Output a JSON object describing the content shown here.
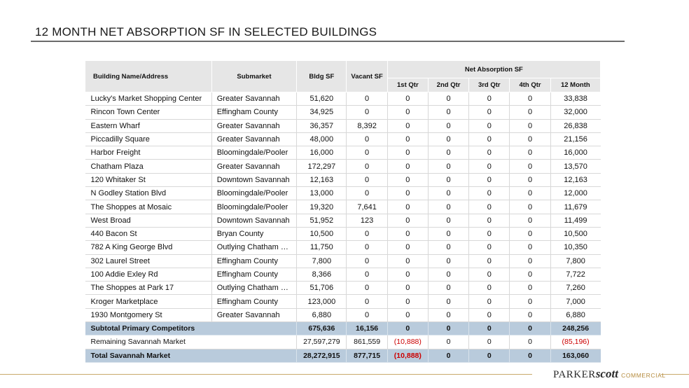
{
  "title": "12 MONTH NET ABSORPTION SF IN SELECTED BUILDINGS",
  "headers": {
    "name": "Building Name/Address",
    "submarket": "Submarket",
    "bldg_sf": "Bldg SF",
    "vacant_sf": "Vacant SF",
    "net_absorption": "Net Absorption SF",
    "q1": "1st Qtr",
    "q2": "2nd Qtr",
    "q3": "3rd Qtr",
    "q4": "4th Qtr",
    "m12": "12 Month"
  },
  "rows": [
    {
      "name": "Lucky's Market Shopping Center",
      "submarket": "Greater Savannah",
      "bldg": "51,620",
      "vacant": "0",
      "q1": "0",
      "q2": "0",
      "q3": "0",
      "q4": "0",
      "m12": "33,838"
    },
    {
      "name": "Rincon Town Center",
      "submarket": "Effingham County",
      "bldg": "34,925",
      "vacant": "0",
      "q1": "0",
      "q2": "0",
      "q3": "0",
      "q4": "0",
      "m12": "32,000"
    },
    {
      "name": "Eastern Wharf",
      "submarket": "Greater Savannah",
      "bldg": "36,357",
      "vacant": "8,392",
      "q1": "0",
      "q2": "0",
      "q3": "0",
      "q4": "0",
      "m12": "26,838"
    },
    {
      "name": "Piccadilly Square",
      "submarket": "Greater Savannah",
      "bldg": "48,000",
      "vacant": "0",
      "q1": "0",
      "q2": "0",
      "q3": "0",
      "q4": "0",
      "m12": "21,156"
    },
    {
      "name": "Harbor Freight",
      "submarket": "Bloomingdale/Pooler",
      "bldg": "16,000",
      "vacant": "0",
      "q1": "0",
      "q2": "0",
      "q3": "0",
      "q4": "0",
      "m12": "16,000"
    },
    {
      "name": "Chatham Plaza",
      "submarket": "Greater Savannah",
      "bldg": "172,297",
      "vacant": "0",
      "q1": "0",
      "q2": "0",
      "q3": "0",
      "q4": "0",
      "m12": "13,570"
    },
    {
      "name": "120 Whitaker St",
      "submarket": "Downtown Savannah",
      "bldg": "12,163",
      "vacant": "0",
      "q1": "0",
      "q2": "0",
      "q3": "0",
      "q4": "0",
      "m12": "12,163"
    },
    {
      "name": "N Godley Station Blvd",
      "submarket": "Bloomingdale/Pooler",
      "bldg": "13,000",
      "vacant": "0",
      "q1": "0",
      "q2": "0",
      "q3": "0",
      "q4": "0",
      "m12": "12,000"
    },
    {
      "name": "The Shoppes at Mosaic",
      "submarket": "Bloomingdale/Pooler",
      "bldg": "19,320",
      "vacant": "7,641",
      "q1": "0",
      "q2": "0",
      "q3": "0",
      "q4": "0",
      "m12": "11,679"
    },
    {
      "name": "West Broad",
      "submarket": "Downtown Savannah",
      "bldg": "51,952",
      "vacant": "123",
      "q1": "0",
      "q2": "0",
      "q3": "0",
      "q4": "0",
      "m12": "11,499"
    },
    {
      "name": "440 Bacon St",
      "submarket": "Bryan County",
      "bldg": "10,500",
      "vacant": "0",
      "q1": "0",
      "q2": "0",
      "q3": "0",
      "q4": "0",
      "m12": "10,500"
    },
    {
      "name": "782 A King George Blvd",
      "submarket": "Outlying Chatham C…",
      "bldg": "11,750",
      "vacant": "0",
      "q1": "0",
      "q2": "0",
      "q3": "0",
      "q4": "0",
      "m12": "10,350"
    },
    {
      "name": "302 Laurel Street",
      "submarket": "Effingham County",
      "bldg": "7,800",
      "vacant": "0",
      "q1": "0",
      "q2": "0",
      "q3": "0",
      "q4": "0",
      "m12": "7,800"
    },
    {
      "name": "100 Addie Exley Rd",
      "submarket": "Effingham County",
      "bldg": "8,366",
      "vacant": "0",
      "q1": "0",
      "q2": "0",
      "q3": "0",
      "q4": "0",
      "m12": "7,722"
    },
    {
      "name": "The Shoppes at Park 17",
      "submarket": "Outlying Chatham C…",
      "bldg": "51,706",
      "vacant": "0",
      "q1": "0",
      "q2": "0",
      "q3": "0",
      "q4": "0",
      "m12": "7,260"
    },
    {
      "name": "Kroger Marketplace",
      "submarket": "Effingham County",
      "bldg": "123,000",
      "vacant": "0",
      "q1": "0",
      "q2": "0",
      "q3": "0",
      "q4": "0",
      "m12": "7,000"
    },
    {
      "name": "1930 Montgomery St",
      "submarket": "Greater Savannah",
      "bldg": "6,880",
      "vacant": "0",
      "q1": "0",
      "q2": "0",
      "q3": "0",
      "q4": "0",
      "m12": "6,880"
    }
  ],
  "subtotal": {
    "label": "Subtotal Primary Competitors",
    "bldg": "675,636",
    "vacant": "16,156",
    "q1": "0",
    "q2": "0",
    "q3": "0",
    "q4": "0",
    "m12": "248,256"
  },
  "remaining": {
    "label": "Remaining Savannah Market",
    "bldg": "27,597,279",
    "vacant": "861,559",
    "q1": "(10,888)",
    "q2": "0",
    "q3": "0",
    "q4": "0",
    "m12": "(85,196)"
  },
  "total": {
    "label": "Total Savannah Market",
    "bldg": "28,272,915",
    "vacant": "877,715",
    "q1": "(10,888)",
    "q2": "0",
    "q3": "0",
    "q4": "0",
    "m12": "163,060"
  },
  "logo": {
    "part1": "PARKER",
    "part2": "scott",
    "part3": "COMMERCIAL"
  },
  "colors": {
    "highlight_row": "#b9cbdc",
    "header": "#e6e6e6",
    "negative": "#cc0000",
    "accent": "#c9a96a"
  }
}
